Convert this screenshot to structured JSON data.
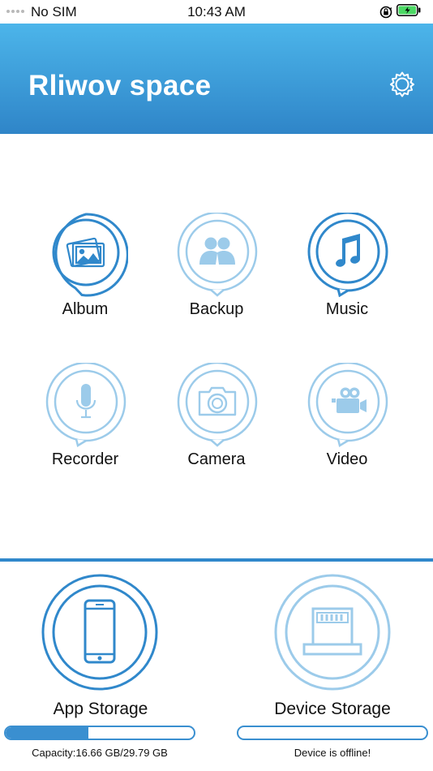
{
  "status_bar": {
    "carrier": "No SIM",
    "time": "10:43 AM"
  },
  "header": {
    "title": "Rliwov space"
  },
  "grid": [
    {
      "label": "Album",
      "icon": "album-icon"
    },
    {
      "label": "Backup",
      "icon": "backup-icon"
    },
    {
      "label": "Music",
      "icon": "music-icon"
    },
    {
      "label": "Recorder",
      "icon": "microphone-icon"
    },
    {
      "label": "Camera",
      "icon": "camera-icon"
    },
    {
      "label": "Video",
      "icon": "video-camera-icon"
    }
  ],
  "storage": {
    "app": {
      "label": "App Storage",
      "capacity": "Capacity:16.66 GB/29.79 GB",
      "used_fraction": 0.44
    },
    "device": {
      "label": "Device Storage",
      "status": "Device is offline!",
      "used_fraction": 0
    }
  },
  "colors": {
    "accent": "#3088cb",
    "header_top": "#4cb5ea",
    "header_bottom": "#2f85c8",
    "disabled_icon": "#9ccbea"
  }
}
